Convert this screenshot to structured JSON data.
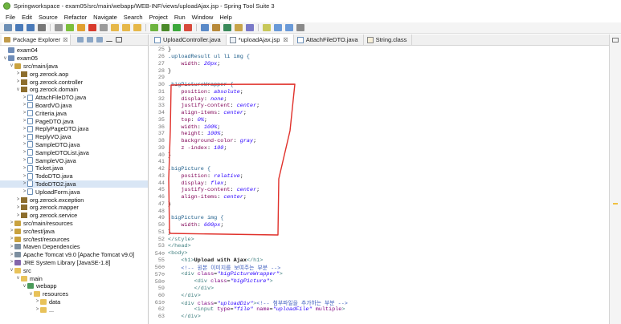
{
  "window": {
    "title": "Springworkspace - exam05/src/main/webapp/WEB-INF/views/uploadAjax.jsp - Spring Tool Suite 3"
  },
  "menu": [
    "File",
    "Edit",
    "Source",
    "Refactor",
    "Navigate",
    "Search",
    "Project",
    "Run",
    "Window",
    "Help"
  ],
  "toolbar": {
    "icons": [
      "new-icon",
      "save-icon",
      "save-all-icon",
      "print-icon",
      "skip-breakpoints-icon",
      "resume-icon",
      "suspend-icon",
      "terminate-icon",
      "disconnect-icon",
      "step-into-icon",
      "step-over-icon",
      "step-return-icon",
      "boot-dashboard-icon",
      "debug-icon",
      "run-icon",
      "external-tools-icon",
      "new-server-icon",
      "new-package-icon",
      "new-class-icon",
      "open-type-icon",
      "search-icon",
      "annotation-icon",
      "navigate-back-icon",
      "navigate-forward-icon",
      "pin-icon"
    ]
  },
  "package_explorer": {
    "tab_label": "Package Explorer",
    "close_glyph": "☒",
    "tree": [
      {
        "label": "exam04",
        "depth": 0,
        "toggle": "",
        "icon": "project"
      },
      {
        "label": "exam05",
        "depth": 0,
        "toggle": "v",
        "icon": "project"
      },
      {
        "label": "src/main/java",
        "depth": 1,
        "toggle": "v",
        "icon": "srcfolder"
      },
      {
        "label": "org.zerock.aop",
        "depth": 2,
        "toggle": ">",
        "icon": "package"
      },
      {
        "label": "org.zerock.controller",
        "depth": 2,
        "toggle": ">",
        "icon": "package"
      },
      {
        "label": "org.zerock.domain",
        "depth": 2,
        "toggle": "v",
        "icon": "package"
      },
      {
        "label": "AttachFileDTO.java",
        "depth": 3,
        "toggle": ">",
        "icon": "java"
      },
      {
        "label": "BoardVO.java",
        "depth": 3,
        "toggle": ">",
        "icon": "java"
      },
      {
        "label": "Criteria.java",
        "depth": 3,
        "toggle": ">",
        "icon": "java"
      },
      {
        "label": "PageDTO.java",
        "depth": 3,
        "toggle": ">",
        "icon": "java"
      },
      {
        "label": "ReplyPageDTO.java",
        "depth": 3,
        "toggle": ">",
        "icon": "java"
      },
      {
        "label": "ReplyVO.java",
        "depth": 3,
        "toggle": ">",
        "icon": "java"
      },
      {
        "label": "SampleDTO.java",
        "depth": 3,
        "toggle": ">",
        "icon": "java"
      },
      {
        "label": "SampleDTOList.java",
        "depth": 3,
        "toggle": ">",
        "icon": "java"
      },
      {
        "label": "SampleVO.java",
        "depth": 3,
        "toggle": ">",
        "icon": "java"
      },
      {
        "label": "Ticket.java",
        "depth": 3,
        "toggle": ">",
        "icon": "java"
      },
      {
        "label": "TodoDTO.java",
        "depth": 3,
        "toggle": ">",
        "icon": "java"
      },
      {
        "label": "TodoDTO2.java",
        "depth": 3,
        "toggle": ">",
        "icon": "java",
        "selected": true
      },
      {
        "label": "UploadForm.java",
        "depth": 3,
        "toggle": ">",
        "icon": "java"
      },
      {
        "label": "org.zerock.exception",
        "depth": 2,
        "toggle": ">",
        "icon": "package"
      },
      {
        "label": "org.zerock.mapper",
        "depth": 2,
        "toggle": ">",
        "icon": "package"
      },
      {
        "label": "org.zerock.service",
        "depth": 2,
        "toggle": ">",
        "icon": "package"
      },
      {
        "label": "src/main/resources",
        "depth": 1,
        "toggle": ">",
        "icon": "srcfolder"
      },
      {
        "label": "src/test/java",
        "depth": 1,
        "toggle": ">",
        "icon": "srcfolder"
      },
      {
        "label": "src/test/resources",
        "depth": 1,
        "toggle": ">",
        "icon": "srcfolder"
      },
      {
        "label": "Maven Dependencies",
        "depth": 1,
        "toggle": ">",
        "icon": "lib"
      },
      {
        "label": "Apache Tomcat v9.0 [Apache Tomcat v9.0]",
        "depth": 1,
        "toggle": ">",
        "icon": "lib"
      },
      {
        "label": "JRE System Library [JavaSE-1.8]",
        "depth": 1,
        "toggle": ">",
        "icon": "jre"
      },
      {
        "label": "src",
        "depth": 1,
        "toggle": "v",
        "icon": "folder"
      },
      {
        "label": "main",
        "depth": 2,
        "toggle": "v",
        "icon": "folder"
      },
      {
        "label": "webapp",
        "depth": 3,
        "toggle": "v",
        "icon": "web"
      },
      {
        "label": "resources",
        "depth": 4,
        "toggle": "v",
        "icon": "folder"
      },
      {
        "label": "data",
        "depth": 5,
        "toggle": ">",
        "icon": "folder"
      },
      {
        "label": "...",
        "depth": 5,
        "toggle": ">",
        "icon": "folder"
      }
    ]
  },
  "editor": {
    "tabs": [
      {
        "label": "UploadController.java",
        "icon": "java",
        "active": false,
        "close": ""
      },
      {
        "label": "*uploadAjax.jsp",
        "icon": "jsp",
        "active": true,
        "close": "☒"
      },
      {
        "label": "AttachFileDTO.java",
        "icon": "java",
        "active": false,
        "close": ""
      },
      {
        "label": "String.class",
        "icon": "class",
        "active": false,
        "close": ""
      }
    ],
    "lines": [
      {
        "n": "25",
        "seg": [
          [
            "}",
            ""
          ]
        ]
      },
      {
        "n": "26",
        "seg": [
          [
            ".uploadResult ul li img {",
            "sel"
          ]
        ]
      },
      {
        "n": "27",
        "seg": [
          [
            "    ",
            ""
          ],
          [
            "width",
            "prop"
          ],
          [
            ": ",
            ""
          ],
          [
            "20px",
            "val"
          ],
          [
            ";",
            ""
          ]
        ]
      },
      {
        "n": "28",
        "seg": [
          [
            "}",
            ""
          ]
        ]
      },
      {
        "n": "29",
        "seg": [
          [
            "",
            ""
          ]
        ]
      },
      {
        "n": "30",
        "seg": [
          [
            ".bigPictureWrapper {",
            "sel"
          ]
        ]
      },
      {
        "n": "31",
        "seg": [
          [
            "    ",
            ""
          ],
          [
            "position",
            "prop"
          ],
          [
            ": ",
            ""
          ],
          [
            "absolute",
            "val"
          ],
          [
            ";",
            ""
          ]
        ]
      },
      {
        "n": "32",
        "seg": [
          [
            "    ",
            ""
          ],
          [
            "display",
            "prop"
          ],
          [
            ": ",
            ""
          ],
          [
            "none",
            "val"
          ],
          [
            ";",
            ""
          ]
        ]
      },
      {
        "n": "33",
        "seg": [
          [
            "    ",
            ""
          ],
          [
            "justify-content",
            "prop"
          ],
          [
            ": ",
            ""
          ],
          [
            "center",
            "val"
          ],
          [
            ";",
            ""
          ]
        ]
      },
      {
        "n": "34",
        "seg": [
          [
            "    ",
            ""
          ],
          [
            "align-items",
            "prop"
          ],
          [
            ": ",
            ""
          ],
          [
            "center",
            "val"
          ],
          [
            ";",
            ""
          ]
        ]
      },
      {
        "n": "35",
        "seg": [
          [
            "    ",
            ""
          ],
          [
            "top",
            "prop"
          ],
          [
            ": ",
            ""
          ],
          [
            "0%",
            "val"
          ],
          [
            ";",
            ""
          ]
        ]
      },
      {
        "n": "36",
        "seg": [
          [
            "    ",
            ""
          ],
          [
            "width",
            "prop"
          ],
          [
            ": ",
            ""
          ],
          [
            "100%",
            "val"
          ],
          [
            ";",
            ""
          ]
        ]
      },
      {
        "n": "37",
        "seg": [
          [
            "    ",
            ""
          ],
          [
            "height",
            "prop"
          ],
          [
            ": ",
            ""
          ],
          [
            "100%",
            "val"
          ],
          [
            ";",
            ""
          ]
        ]
      },
      {
        "n": "38",
        "seg": [
          [
            "    ",
            ""
          ],
          [
            "background-color",
            "prop"
          ],
          [
            ": ",
            ""
          ],
          [
            "gray",
            "val"
          ],
          [
            ";",
            ""
          ]
        ]
      },
      {
        "n": "39",
        "seg": [
          [
            "    ",
            ""
          ],
          [
            "z -index",
            "prop"
          ],
          [
            ": ",
            ""
          ],
          [
            "100",
            "val"
          ],
          [
            ";",
            ""
          ]
        ]
      },
      {
        "n": "40",
        "seg": [
          [
            "}",
            ""
          ]
        ]
      },
      {
        "n": "41",
        "seg": [
          [
            "",
            ""
          ]
        ]
      },
      {
        "n": "42",
        "seg": [
          [
            ".bigPicture {",
            "sel"
          ]
        ]
      },
      {
        "n": "43",
        "seg": [
          [
            "    ",
            ""
          ],
          [
            "position",
            "prop"
          ],
          [
            ": ",
            ""
          ],
          [
            "relative",
            "val"
          ],
          [
            ";",
            ""
          ]
        ]
      },
      {
        "n": "44",
        "seg": [
          [
            "    ",
            ""
          ],
          [
            "display",
            "prop"
          ],
          [
            ": ",
            ""
          ],
          [
            "flex",
            "val"
          ],
          [
            ";",
            ""
          ]
        ]
      },
      {
        "n": "45",
        "seg": [
          [
            "    ",
            ""
          ],
          [
            "justify-content",
            "prop"
          ],
          [
            ": ",
            ""
          ],
          [
            "center",
            "val"
          ],
          [
            ";",
            ""
          ]
        ]
      },
      {
        "n": "46",
        "seg": [
          [
            "    ",
            ""
          ],
          [
            "align-items",
            "prop"
          ],
          [
            ": ",
            ""
          ],
          [
            "center",
            "val"
          ],
          [
            ";",
            ""
          ]
        ]
      },
      {
        "n": "47",
        "seg": [
          [
            "}",
            ""
          ]
        ]
      },
      {
        "n": "48",
        "seg": [
          [
            "",
            ""
          ]
        ]
      },
      {
        "n": "49",
        "seg": [
          [
            ".bigPicture img {",
            "sel"
          ]
        ]
      },
      {
        "n": "50",
        "seg": [
          [
            "    ",
            ""
          ],
          [
            "width",
            "prop"
          ],
          [
            ": ",
            ""
          ],
          [
            "600px",
            "val"
          ],
          [
            ";",
            ""
          ]
        ]
      },
      {
        "n": "51",
        "seg": [
          [
            "}",
            ""
          ]
        ]
      },
      {
        "n": "52",
        "seg": [
          [
            "</",
            "tag"
          ],
          [
            "style",
            "tag"
          ],
          [
            ">",
            "tag"
          ]
        ]
      },
      {
        "n": "53",
        "seg": [
          [
            "</",
            "tag"
          ],
          [
            "head",
            "tag"
          ],
          [
            ">",
            "tag"
          ]
        ]
      },
      {
        "n": "54⊖",
        "seg": [
          [
            "<",
            "tag"
          ],
          [
            "body",
            "tag"
          ],
          [
            ">",
            "tag"
          ]
        ]
      },
      {
        "n": "55",
        "seg": [
          [
            "    <",
            "tag"
          ],
          [
            "h1",
            "tag"
          ],
          [
            ">",
            "tag"
          ],
          [
            "Upload with Ajax",
            "bold"
          ],
          [
            "</",
            "tag"
          ],
          [
            "h1",
            "tag"
          ],
          [
            ">",
            "tag"
          ]
        ]
      },
      {
        "n": "56⊖",
        "seg": [
          [
            "    ",
            ""
          ],
          [
            "<!-- 원본 이미지를 보여주는 부분 -->",
            "com"
          ]
        ]
      },
      {
        "n": "57⊖",
        "seg": [
          [
            "    <",
            "tag"
          ],
          [
            "div",
            "tag"
          ],
          [
            " ",
            ""
          ],
          [
            "class",
            "attr"
          ],
          [
            "=",
            ""
          ],
          [
            "\"bigPictureWrapper\"",
            "str"
          ],
          [
            ">",
            "tag"
          ]
        ]
      },
      {
        "n": "58⊖",
        "seg": [
          [
            "        <",
            "tag"
          ],
          [
            "div",
            "tag"
          ],
          [
            " ",
            ""
          ],
          [
            "class",
            "attr"
          ],
          [
            "=",
            ""
          ],
          [
            "\"bigPicture\"",
            "str"
          ],
          [
            ">",
            "tag"
          ]
        ]
      },
      {
        "n": "59",
        "seg": [
          [
            "        </",
            "tag"
          ],
          [
            "div",
            "tag"
          ],
          [
            ">",
            "tag"
          ]
        ]
      },
      {
        "n": "60",
        "seg": [
          [
            "    </",
            "tag"
          ],
          [
            "div",
            "tag"
          ],
          [
            ">",
            "tag"
          ]
        ]
      },
      {
        "n": "61⊖",
        "seg": [
          [
            "    <",
            "tag"
          ],
          [
            "div",
            "tag"
          ],
          [
            " ",
            ""
          ],
          [
            "class",
            "attr"
          ],
          [
            "=",
            ""
          ],
          [
            "\"uploadDiv\"",
            "str"
          ],
          [
            ">",
            "tag"
          ],
          [
            "<!-- 첨부파일을 추가하는 부분 -->",
            "com"
          ]
        ]
      },
      {
        "n": "62",
        "seg": [
          [
            "        <",
            "tag"
          ],
          [
            "input",
            "tag"
          ],
          [
            " ",
            ""
          ],
          [
            "type",
            "attr"
          ],
          [
            "=",
            ""
          ],
          [
            "\"file\"",
            "str"
          ],
          [
            " ",
            ""
          ],
          [
            "name",
            "attr"
          ],
          [
            "=",
            ""
          ],
          [
            "\"uploadFile\"",
            "str"
          ],
          [
            " ",
            ""
          ],
          [
            "multiple",
            "attr"
          ],
          [
            ">",
            "tag"
          ]
        ]
      },
      {
        "n": "63",
        "seg": [
          [
            "    </",
            "tag"
          ],
          [
            "div",
            "tag"
          ],
          [
            ">",
            "tag"
          ]
        ]
      }
    ]
  },
  "colors": {
    "annotation_red": "#e0302a",
    "selection_blue": "#d9e6f5",
    "toolbar_bg": "#f4f4f4"
  }
}
